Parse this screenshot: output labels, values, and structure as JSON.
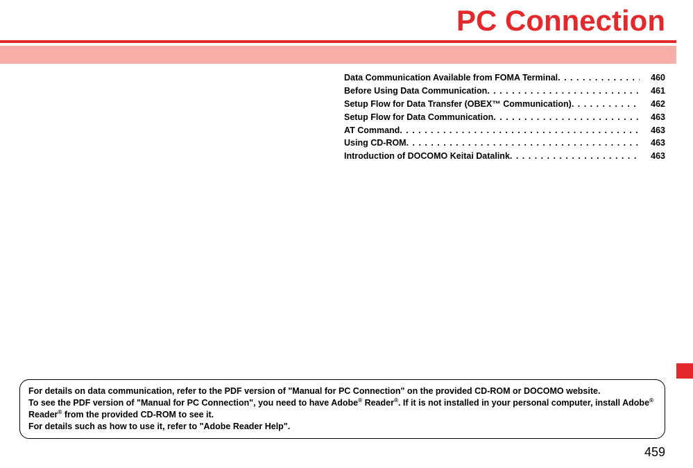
{
  "title": "PC Connection",
  "toc": [
    {
      "label": "Data Communication Available from FOMA Terminal",
      "page": "460"
    },
    {
      "label": "Before Using Data Communication",
      "page": "461"
    },
    {
      "label": "Setup Flow for Data Transfer (OBEX™ Communication)",
      "page": "462"
    },
    {
      "label": "Setup Flow for Data Communication",
      "page": "463"
    },
    {
      "label": "AT Command",
      "page": "463"
    },
    {
      "label": "Using CD-ROM",
      "page": "463"
    },
    {
      "label": "Introduction of DOCOMO Keitai Datalink",
      "page": "463"
    }
  ],
  "note": {
    "line1": "For details on data communication, refer to the PDF version of \"Manual for PC Connection\" on the provided CD-ROM or DOCOMO website.",
    "line2_a": "To see the PDF version of \"Manual for PC Connection\", you need to have Adobe",
    "line2_b": " Reader",
    "line2_c": ". If it is not installed in your personal computer, install Adobe",
    "line2_d": " Reader",
    "line2_e": " from the provided CD-ROM to see it.",
    "line3": "For details such as how to use it, refer to \"Adobe Reader Help\"."
  },
  "pageNumber": "459"
}
